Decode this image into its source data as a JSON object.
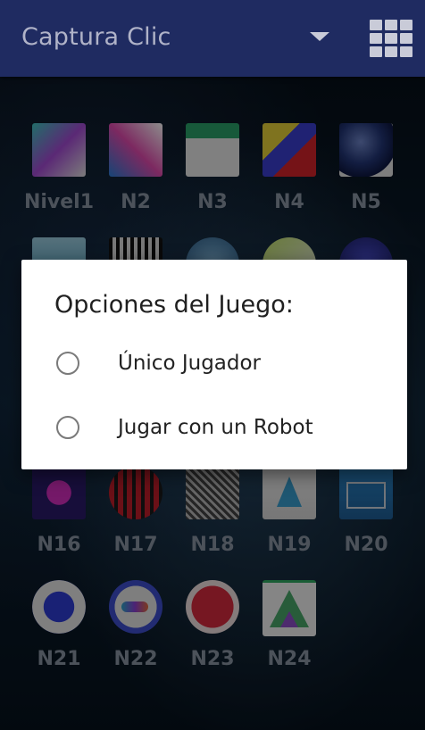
{
  "appbar": {
    "title": "Captura Clic"
  },
  "levels": [
    {
      "label": "Nivel1"
    },
    {
      "label": "N2"
    },
    {
      "label": "N3"
    },
    {
      "label": "N4"
    },
    {
      "label": "N5"
    },
    {
      "label": "N16"
    },
    {
      "label": "N17"
    },
    {
      "label": "N18"
    },
    {
      "label": "N19"
    },
    {
      "label": "N20"
    },
    {
      "label": "N21"
    },
    {
      "label": "N22"
    },
    {
      "label": "N23"
    },
    {
      "label": "N24"
    }
  ],
  "dialog": {
    "title": "Opciones del Juego:",
    "options": [
      {
        "label": "Único Jugador"
      },
      {
        "label": "Jugar con un Robot"
      }
    ]
  }
}
